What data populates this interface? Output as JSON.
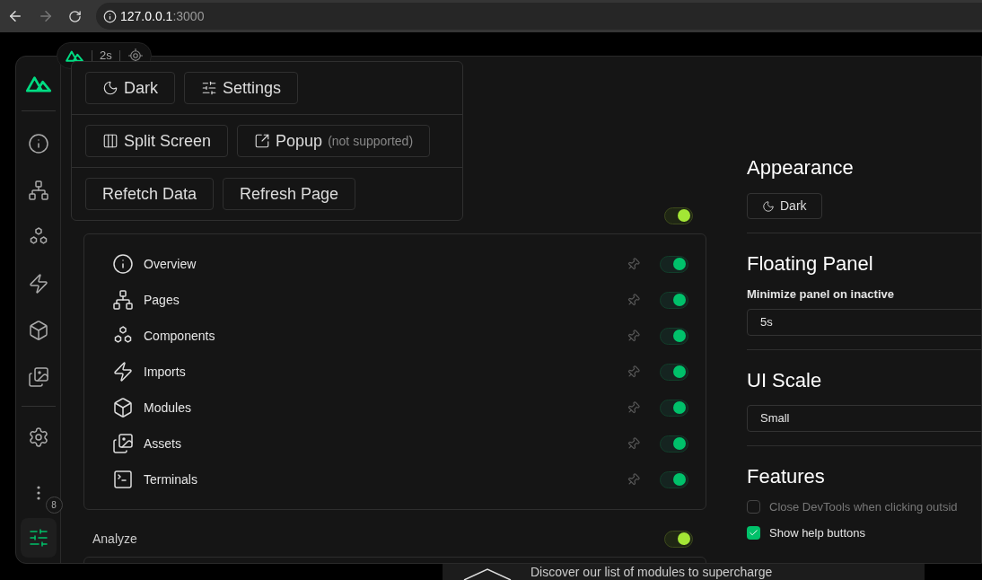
{
  "browser": {
    "host": "127.0.0.1",
    "port": ":3000"
  },
  "floating_pill": {
    "timer": "2s"
  },
  "popover": {
    "rows": [
      [
        {
          "kind": "theme",
          "label": "Dark"
        },
        {
          "kind": "settings",
          "label": "Settings"
        }
      ],
      [
        {
          "kind": "split",
          "label": "Split Screen"
        },
        {
          "kind": "popup",
          "label": "Popup",
          "note": "(not supported)"
        }
      ],
      [
        {
          "kind": "plain",
          "label": "Refetch Data"
        },
        {
          "kind": "plain",
          "label": "Refresh Page"
        }
      ]
    ]
  },
  "sidebar": {
    "items": [
      {
        "kind": "info",
        "selected": false
      },
      {
        "kind": "tree",
        "selected": false
      },
      {
        "kind": "hexagons",
        "selected": false
      },
      {
        "kind": "bolt",
        "selected": false
      },
      {
        "kind": "cube",
        "selected": false
      },
      {
        "kind": "images",
        "selected": false
      }
    ],
    "bottom_items": [
      {
        "kind": "gear",
        "selected": false
      },
      {
        "kind": "more",
        "badge": "8",
        "selected": false
      },
      {
        "kind": "sliders",
        "selected": true
      }
    ]
  },
  "groups": [
    {
      "on": true,
      "tabs": [
        {
          "kind": "info",
          "label": "Overview",
          "pinned": false,
          "on": true
        },
        {
          "kind": "tree",
          "label": "Pages",
          "pinned": false,
          "on": true
        },
        {
          "kind": "hexagons",
          "label": "Components",
          "pinned": false,
          "on": true
        },
        {
          "kind": "bolt",
          "label": "Imports",
          "pinned": false,
          "on": true
        },
        {
          "kind": "cube",
          "label": "Modules",
          "pinned": false,
          "on": true
        },
        {
          "kind": "images",
          "label": "Assets",
          "pinned": false,
          "on": true
        },
        {
          "kind": "terminal",
          "label": "Terminals",
          "pinned": false,
          "on": true
        }
      ]
    },
    {
      "title": "Analyze",
      "on": true
    }
  ],
  "settings": {
    "appearance": {
      "title": "Appearance",
      "button": "Dark"
    },
    "floating_panel": {
      "title": "Floating Panel",
      "label": "Minimize panel on inactive",
      "value": "5s"
    },
    "ui_scale": {
      "title": "UI Scale",
      "value": "Small"
    },
    "features": {
      "title": "Features",
      "options": [
        {
          "label": "Close DevTools when clicking outsid",
          "checked": false
        },
        {
          "label": "Show help buttons",
          "checked": true
        }
      ]
    }
  },
  "banner": {
    "text": "Discover our list of modules to supercharge"
  }
}
